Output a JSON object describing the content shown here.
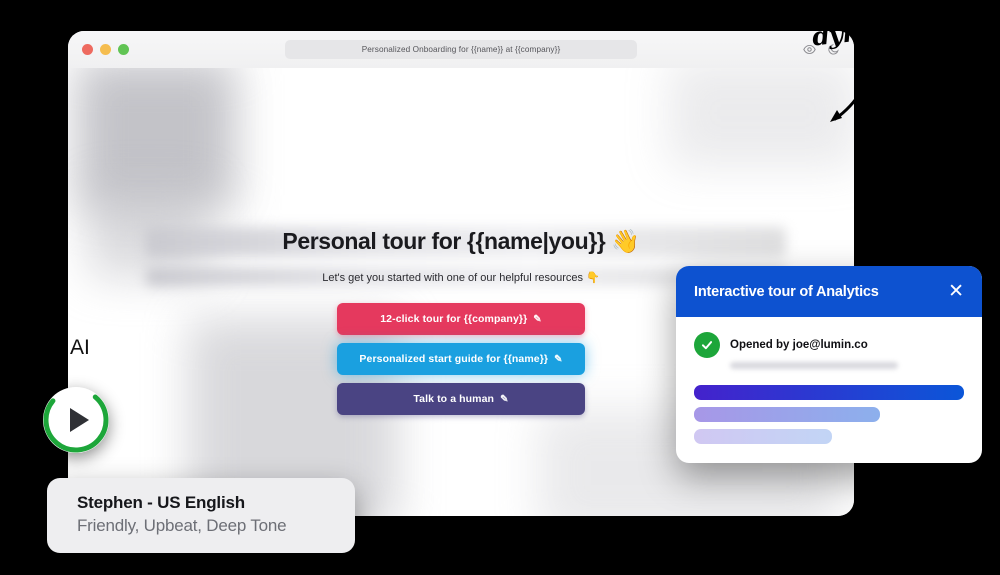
{
  "annotations": {
    "handwriting": "dynam",
    "ai_fragment": "AI",
    "arrow_icon": "hand-drawn-arrow-icon"
  },
  "browser": {
    "titlebar": {
      "url_text": "Personalized Onboarding for {{name}} at {{company}}",
      "traffic_lights": [
        "close",
        "minimize",
        "maximize"
      ],
      "icons": [
        {
          "name": "eye-icon",
          "glyph": "eye"
        },
        {
          "name": "moon-icon",
          "glyph": "moon"
        }
      ]
    },
    "page": {
      "headline": "Personal tour for {{name|you}} 👋",
      "subline": "Let's get you started with one of our helpful resources 👇",
      "ctas": [
        {
          "label": "12-click tour for {{company}}",
          "pencil": "✎",
          "color": "#e5395e"
        },
        {
          "label": "Personalized start guide for {{name}}",
          "pencil": "✎",
          "color": "#1aa0e0"
        },
        {
          "label": "Talk to a human",
          "pencil": "✎",
          "color": "#4a4483"
        }
      ]
    }
  },
  "tour_card": {
    "title": "Interactive tour of Analytics",
    "close_label": "✕",
    "status_text": "Opened by joe@lumin.co",
    "status_icon": "check-circle-icon",
    "accent_color": "#0d52d0",
    "check_color": "#1da63a",
    "bars": [
      {
        "width": "100%",
        "opacity": 1
      },
      {
        "width": "69%",
        "opacity": 0.47
      },
      {
        "width": "51%",
        "opacity": 0.25
      }
    ]
  },
  "voice_widget": {
    "play_icon": "play-icon",
    "ring_color": "#1da63a",
    "progress_percent": 75,
    "name": "Stephen - US English",
    "description": "Friendly, Upbeat, Deep Tone"
  }
}
